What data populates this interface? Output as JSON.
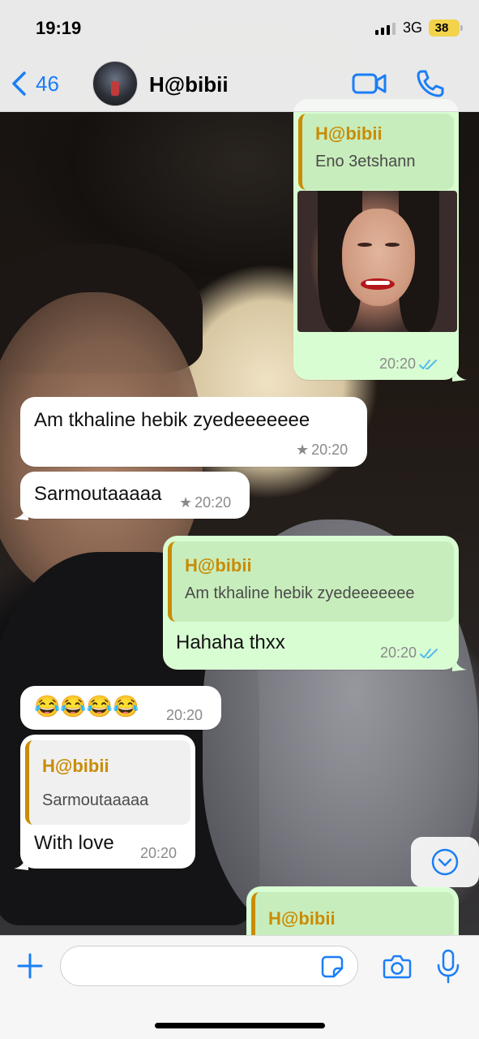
{
  "status_bar": {
    "time": "19:19",
    "network": "3G",
    "battery": "38"
  },
  "header": {
    "back_count": "46",
    "contact_name": "H@bibii",
    "icons": [
      "chevron-left-icon",
      "video-call-icon",
      "phone-icon"
    ]
  },
  "colors": {
    "accent": "#1a7ef7",
    "outgoing_bubble": "#d9fdd3",
    "quote_author": "#c98c06",
    "read_ticks": "#53bdeb"
  },
  "messages": [
    {
      "direction": "outgoing",
      "quote_author": "H@bibii",
      "quote_text": "Eno 3etshann",
      "has_photo": true,
      "time": "20:20",
      "status": "read"
    },
    {
      "direction": "incoming",
      "text": "Am tkhaline hebik zyedeeeeeee",
      "time": "20:20",
      "starred": true
    },
    {
      "direction": "incoming",
      "text": "Sarmoutaaaaa",
      "time": "20:20",
      "starred": true
    },
    {
      "direction": "outgoing",
      "quote_author": "H@bibii",
      "quote_text": "Am tkhaline hebik zyedeeeeeee",
      "text": "Hahaha thxx",
      "time": "20:20",
      "status": "read"
    },
    {
      "direction": "incoming",
      "text": "😂😂😂😂",
      "time": "20:20"
    },
    {
      "direction": "incoming",
      "quote_author": "H@bibii",
      "quote_text": "Sarmoutaaaaa",
      "text": "With love",
      "time": "20:20"
    },
    {
      "direction": "outgoing",
      "quote_author": "H@bibii",
      "partial": true
    }
  ],
  "star_glyph": "★",
  "input_bar": {
    "placeholder": "",
    "icons": [
      "plus-icon",
      "sticker-icon",
      "camera-icon",
      "microphone-icon"
    ]
  }
}
